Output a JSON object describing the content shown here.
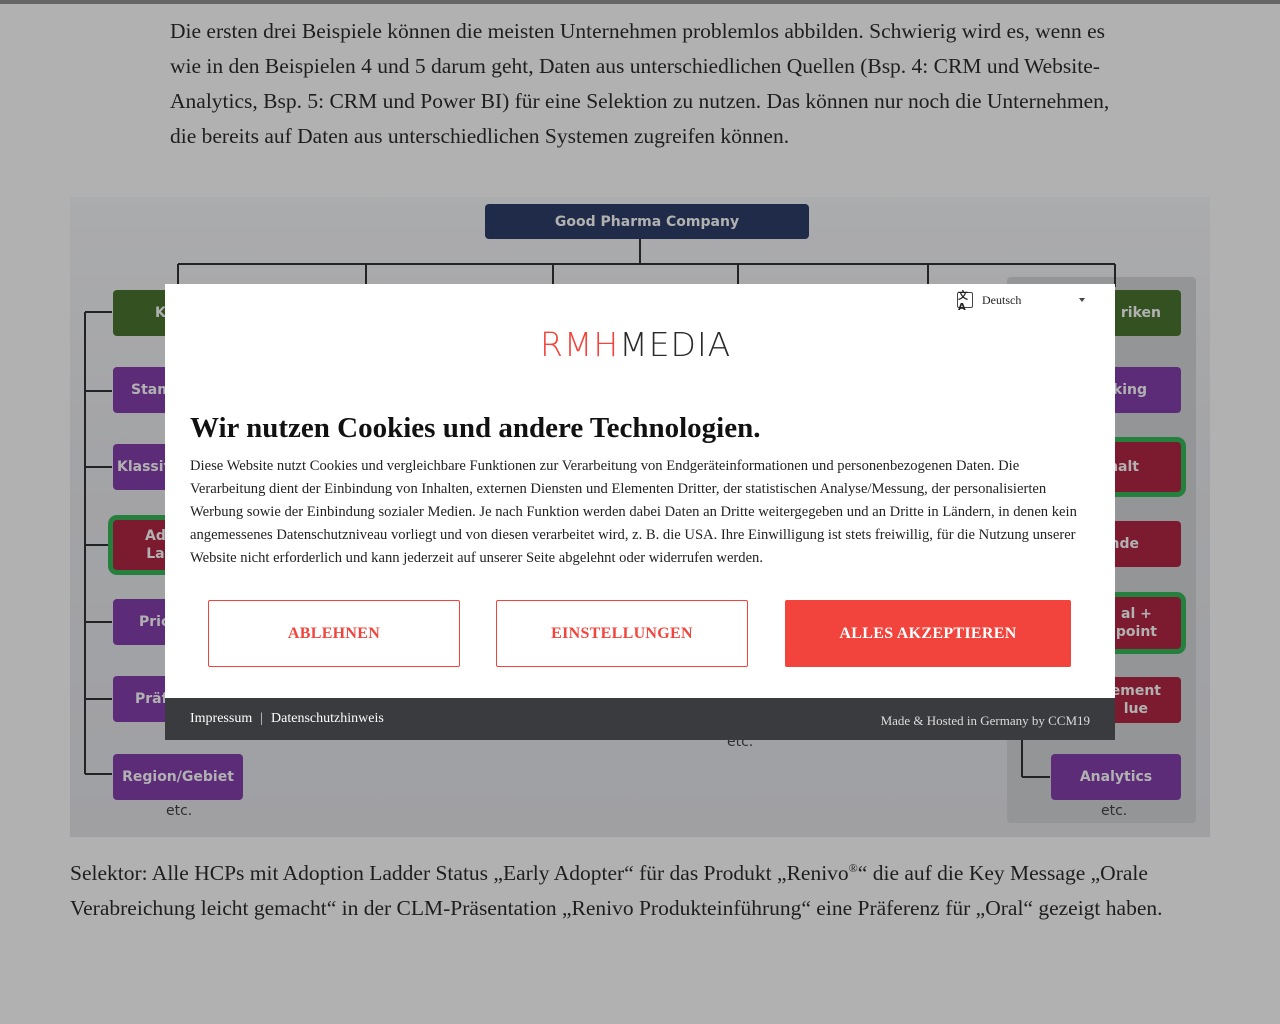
{
  "article": {
    "paragraph_1": "Die ersten drei Beispiele können die meisten Unternehmen problemlos abbilden. Schwierig wird es, wenn es wie in den Beispielen 4 und 5 darum geht, Daten aus unterschiedlichen Quellen (Bsp. 4: CRM und Website-Analytics, Bsp. 5: CRM und Power BI) für eine Selektion zu nutzen. Das können nur noch die Unternehmen, die bereits auf Daten aus unterschiedlichen Systemen zugreifen können.",
    "paragraph_2_before_sup": "Selektor: Alle HCPs mit Adoption Ladder Status „Early Adopter“ für das Produkt „Renivo",
    "paragraph_2_sup": "®",
    "paragraph_2_after_sup": "“ die auf die Key Message „Orale Verabreichung leicht gemacht“ in der CLM-Präsentation „Renivo Produkteinführung“ eine Präferenz für „Oral“ gezeigt haben."
  },
  "figure": {
    "root": "Good Pharma Company",
    "left_nodes": [
      "K",
      "Stam",
      "Klassif",
      "Ad\nLa",
      "Pric",
      "Präf",
      "Region/Gebiet"
    ],
    "right_nodes": [
      "riken",
      "king",
      "halt",
      "nde",
      "al +\npoint",
      "ement\nlue",
      "Analytics"
    ],
    "etc_label": "etc.",
    "colors": {
      "navy": "#1b2e5b",
      "green": "#3c6a1f",
      "purple": "#7b2fa8",
      "red": "#ad1536",
      "highlight": "#27b24a"
    }
  },
  "cookie_banner": {
    "language": {
      "icon": "translate-icon",
      "icon_text": "文A",
      "selected": "Deutsch"
    },
    "logo": {
      "part1": "RMH",
      "part2": "MEDIA"
    },
    "title": "Wir nutzen Cookies und andere Technologien.",
    "text": "Diese Website nutzt Cookies und vergleichbare Funktionen zur Verarbeitung von Endgeräteinformationen und personenbezogenen Daten. Die Verarbeitung dient der Einbindung von Inhalten, externen Diensten und Elementen Dritter, der statistischen Analyse/Messung, der personalisierten Werbung sowie der Einbindung sozialer Medien. Je nach Funktion werden dabei Daten an Dritte weitergegeben und an Dritte in Ländern, in denen kein angemessenes Datenschutzniveau vorliegt und von diesen verarbeitet wird, z. B. die USA. Ihre Einwilligung ist stets freiwillig, für die Nutzung unserer Website nicht erforderlich und kann jederzeit auf unserer Seite abgelehnt oder widerrufen werden.",
    "buttons": {
      "decline": "ABLEHNEN",
      "settings": "EINSTELLUNGEN",
      "accept": "ALLES AKZEPTIEREN"
    },
    "footer": {
      "impressum": "Impressum",
      "separator": "|",
      "privacy": "Datenschutzhinweis",
      "made_by": "Made & Hosted in Germany by CCM19"
    },
    "accent_color": "#f2443c"
  }
}
